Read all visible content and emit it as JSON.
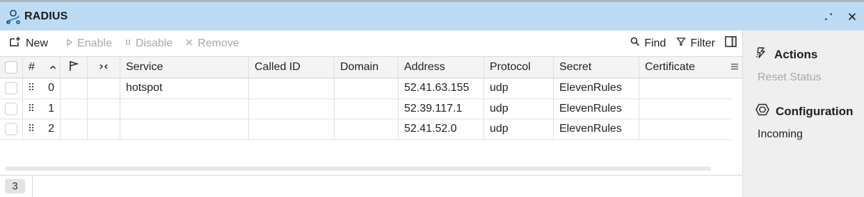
{
  "window": {
    "title": "RADIUS"
  },
  "toolbar": {
    "new_label": "New",
    "enable_label": "Enable",
    "disable_label": "Disable",
    "remove_label": "Remove",
    "find_label": "Find",
    "filter_label": "Filter"
  },
  "table": {
    "headers": {
      "num": "#",
      "service": "Service",
      "called_id": "Called ID",
      "domain": "Domain",
      "address": "Address",
      "protocol": "Protocol",
      "secret": "Secret",
      "certificate": "Certificate"
    },
    "rows": [
      {
        "num": "0",
        "service": "hotspot",
        "called_id": "",
        "domain": "",
        "address": "52.41.63.155",
        "protocol": "udp",
        "secret": "ElevenRules",
        "certificate": ""
      },
      {
        "num": "1",
        "service": "",
        "called_id": "",
        "domain": "",
        "address": "52.39.117.1",
        "protocol": "udp",
        "secret": "ElevenRules",
        "certificate": ""
      },
      {
        "num": "2",
        "service": "",
        "called_id": "",
        "domain": "",
        "address": "52.41.52.0",
        "protocol": "udp",
        "secret": "ElevenRules",
        "certificate": ""
      }
    ]
  },
  "footer": {
    "count": "3"
  },
  "sidebar": {
    "actions_title": "Actions",
    "reset_status_label": "Reset Status",
    "configuration_title": "Configuration",
    "incoming_label": "Incoming"
  },
  "colors": {
    "titlebar": "#bddcf3",
    "accent": "#2a7bd0",
    "disabled_text": "#a8a8a8",
    "sidebar_bg": "#efefef"
  }
}
